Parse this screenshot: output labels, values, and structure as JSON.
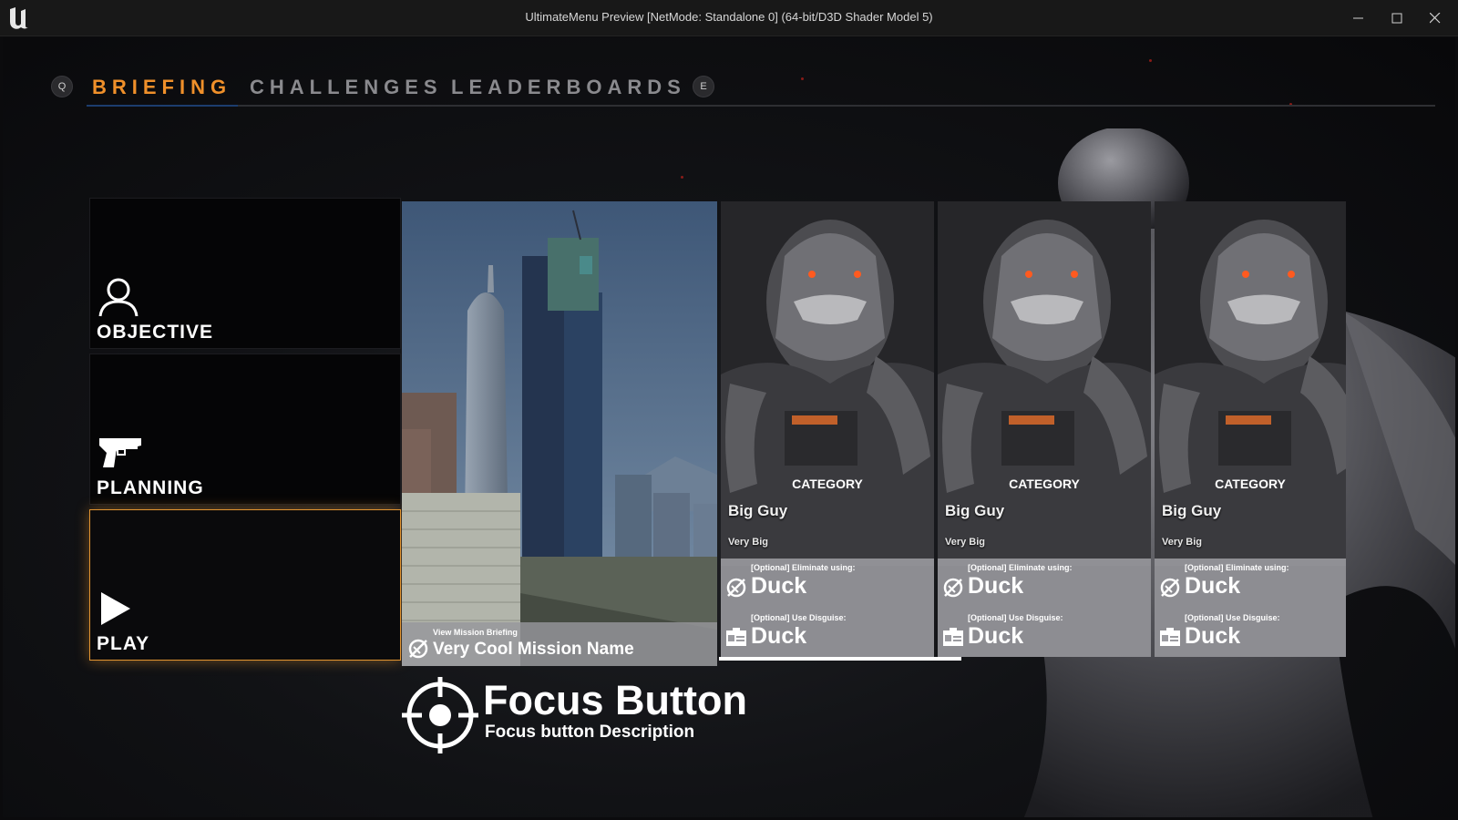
{
  "window": {
    "title": "UltimateMenu Preview [NetMode: Standalone 0]  (64-bit/D3D Shader Model 5)"
  },
  "tabs": {
    "prev_key": "Q",
    "next_key": "E",
    "items": [
      {
        "label": "BRIEFING",
        "active": true
      },
      {
        "label": "CHALLENGES",
        "active": false
      },
      {
        "label": "LEADERBOARDS",
        "active": false
      }
    ]
  },
  "menu": {
    "items": [
      {
        "label": "OBJECTIVE",
        "icon": "person-icon",
        "selected": false
      },
      {
        "label": "PLANNING",
        "icon": "pistol-icon",
        "selected": false
      },
      {
        "label": "PLAY",
        "icon": "play-icon",
        "selected": true
      }
    ]
  },
  "mission": {
    "subtitle": "View Mission Briefing",
    "name": "Very Cool Mission Name"
  },
  "targets": [
    {
      "category": "CATEGORY",
      "name": "Big Guy",
      "sub": "Very Big",
      "eliminate_label": "[Optional] Eliminate using:",
      "eliminate_value": "Duck",
      "disguise_label": "[Optional] Use Disguise:",
      "disguise_value": "Duck"
    },
    {
      "category": "CATEGORY",
      "name": "Big Guy",
      "sub": "Very Big",
      "eliminate_label": "[Optional] Eliminate using:",
      "eliminate_value": "Duck",
      "disguise_label": "[Optional] Use Disguise:",
      "disguise_value": "Duck"
    },
    {
      "category": "CATEGORY",
      "name": "Big Guy",
      "sub": "Very Big",
      "eliminate_label": "[Optional] Eliminate using:",
      "eliminate_value": "Duck",
      "disguise_label": "[Optional] Use Disguise:",
      "disguise_value": "Duck"
    }
  ],
  "focus": {
    "title": "Focus Button",
    "description": "Focus button Description"
  },
  "colors": {
    "accent": "#f0902a",
    "selected_border": "#e39531"
  }
}
